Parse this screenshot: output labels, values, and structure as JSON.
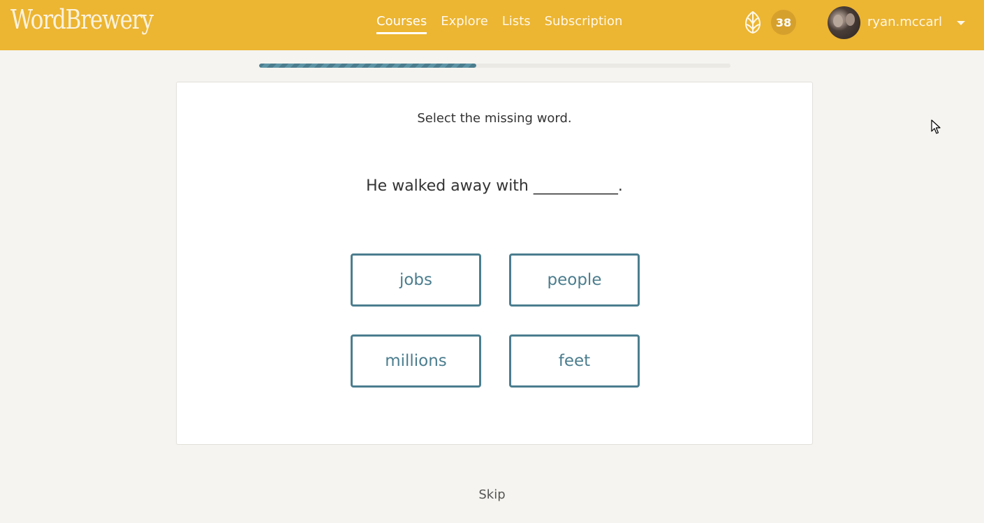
{
  "header": {
    "logo": "WordBrewery",
    "nav": [
      {
        "label": "Courses",
        "active": true
      },
      {
        "label": "Explore",
        "active": false
      },
      {
        "label": "Lists",
        "active": false
      },
      {
        "label": "Subscription",
        "active": false
      }
    ],
    "hops_icon": "hop-icon",
    "score": "38",
    "username": "ryan.mccarl",
    "brand_color": "#ecb532"
  },
  "progress": {
    "fraction": 0.46,
    "color": "#4b7d8e"
  },
  "exercise": {
    "instruction": "Select the missing word.",
    "sentence": "He walked away with ___________.",
    "options": [
      "jobs",
      "people",
      "millions",
      "feet"
    ],
    "accent_color": "#4b7d8e"
  },
  "footer": {
    "skip_label": "Skip"
  }
}
